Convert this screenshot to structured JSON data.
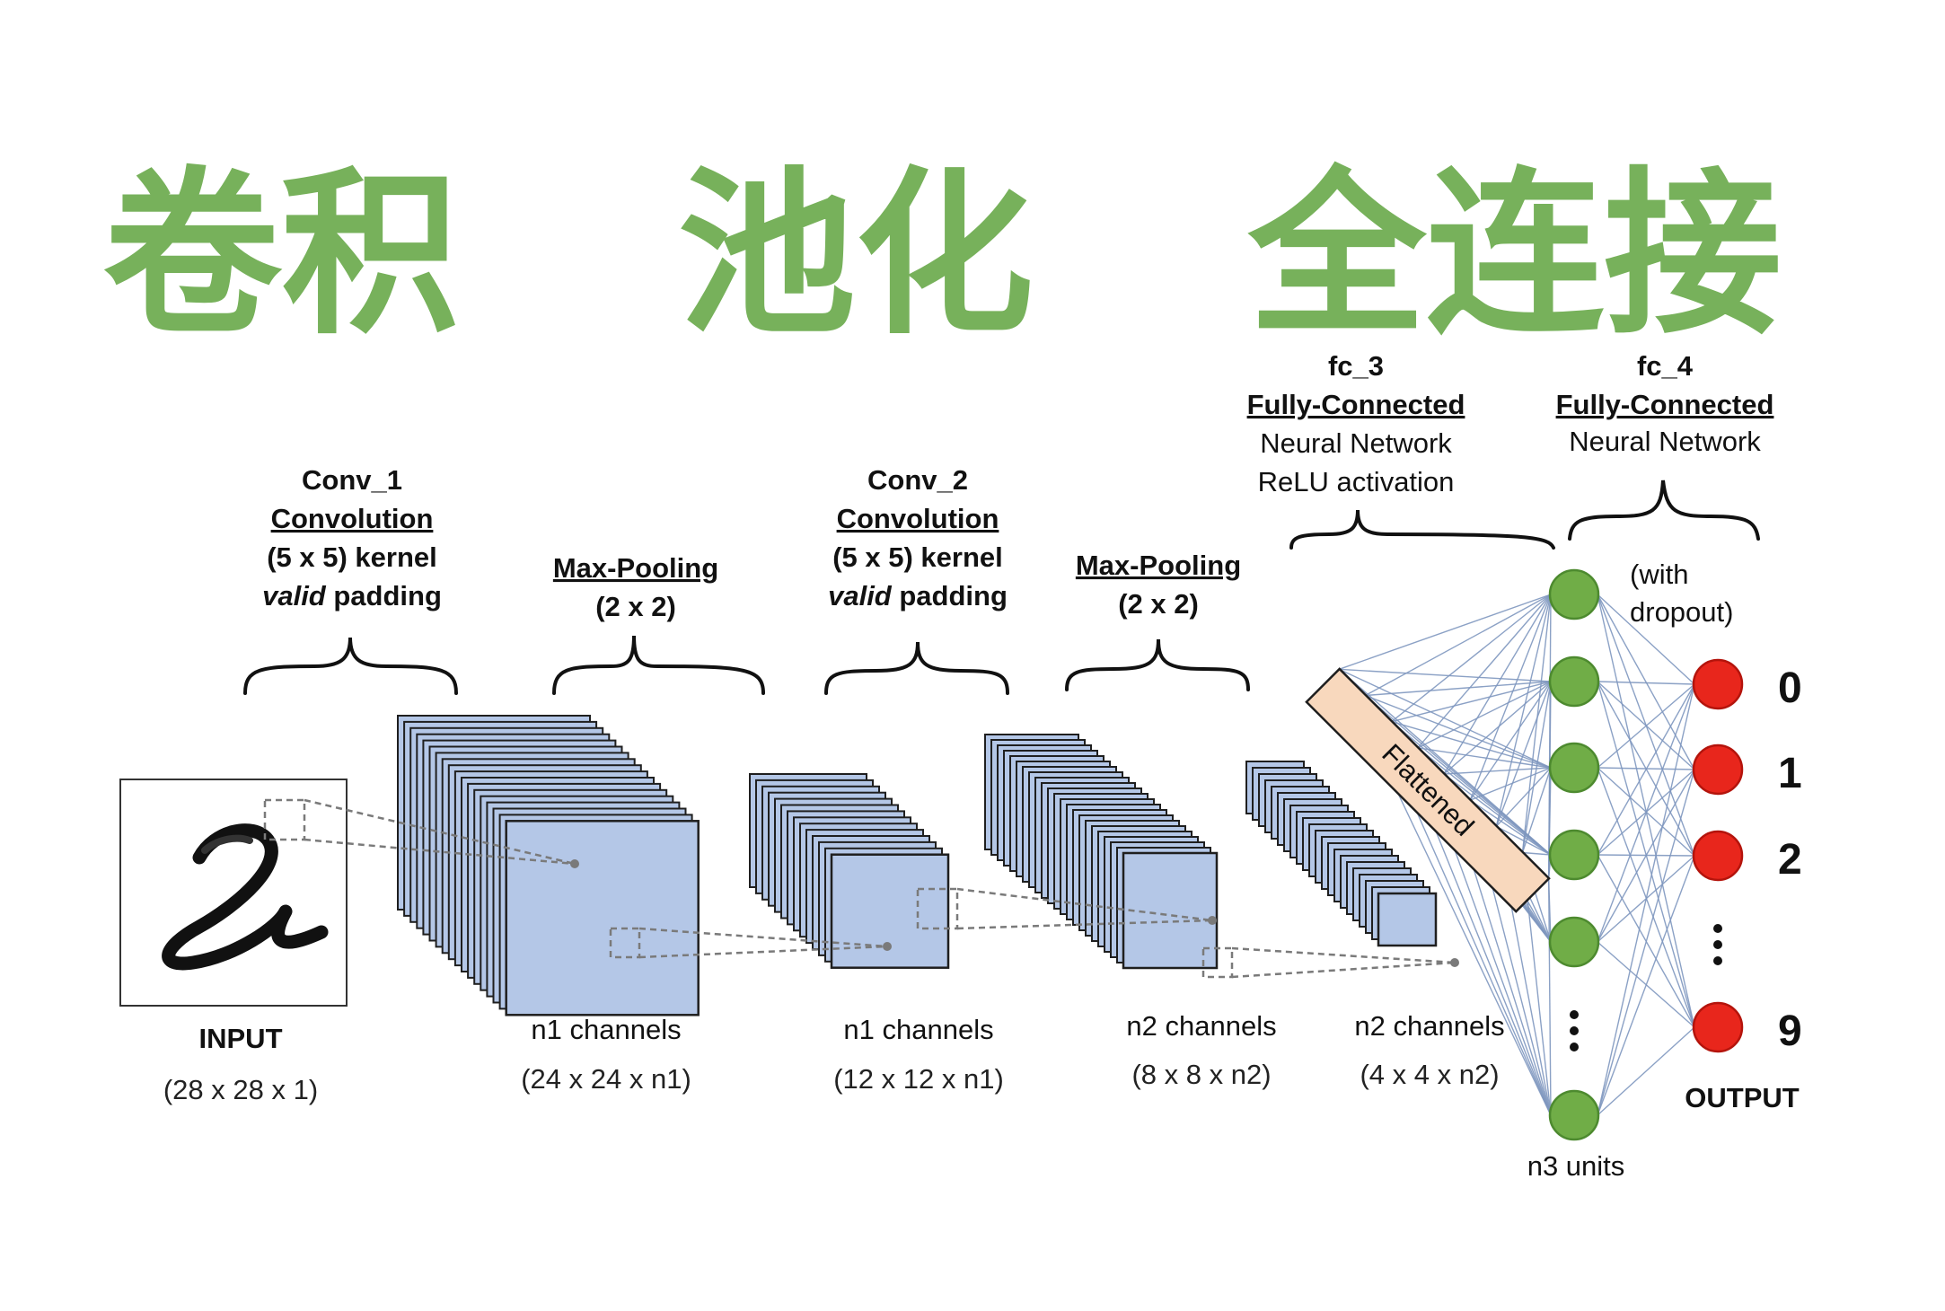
{
  "title": {
    "conv": "卷积",
    "pool": "池化",
    "fc": "全连接"
  },
  "input": {
    "label": "INPUT",
    "dims": "(28 x 28 x 1)"
  },
  "conv1": {
    "name": "Conv_1",
    "type": "Convolution",
    "kernel": "(5 x 5) kernel",
    "padding_em": "valid",
    "padding_rest": " padding",
    "channels": "n1 channels",
    "dims": "(24 x 24 x n1)"
  },
  "pool1": {
    "type": "Max-Pooling",
    "size": "(2 x 2)",
    "channels": "n1 channels",
    "dims": "(12 x 12 x n1)"
  },
  "conv2": {
    "name": "Conv_2",
    "type": "Convolution",
    "kernel": "(5 x 5) kernel",
    "padding_em": "valid",
    "padding_rest": " padding",
    "channels": "n2 channels",
    "dims": "(8 x 8 x n2)"
  },
  "pool2": {
    "type": "Max-Pooling",
    "size": "(2 x 2)",
    "channels": "n2 channels",
    "dims": "(4 x 4 x n2)"
  },
  "flatten": {
    "label": "Flattened"
  },
  "fc3": {
    "name": "fc_3",
    "type": "Fully-Connected",
    "desc": "Neural Network",
    "activation": "ReLU activation",
    "units": "n3 units"
  },
  "fc4": {
    "name": "fc_4",
    "type": "Fully-Connected",
    "desc": "Neural Network",
    "dropout_1": "(with",
    "dropout_2": "dropout)"
  },
  "output": {
    "label": "OUTPUT",
    "digits": [
      "0",
      "1",
      "2",
      "9"
    ]
  },
  "colors": {
    "title_green": "#77b15b",
    "feature_map": "#b4c7e7",
    "flatten": "#f8d8bd",
    "hidden_node": "#70ad47",
    "output_node": "#e8261c"
  }
}
